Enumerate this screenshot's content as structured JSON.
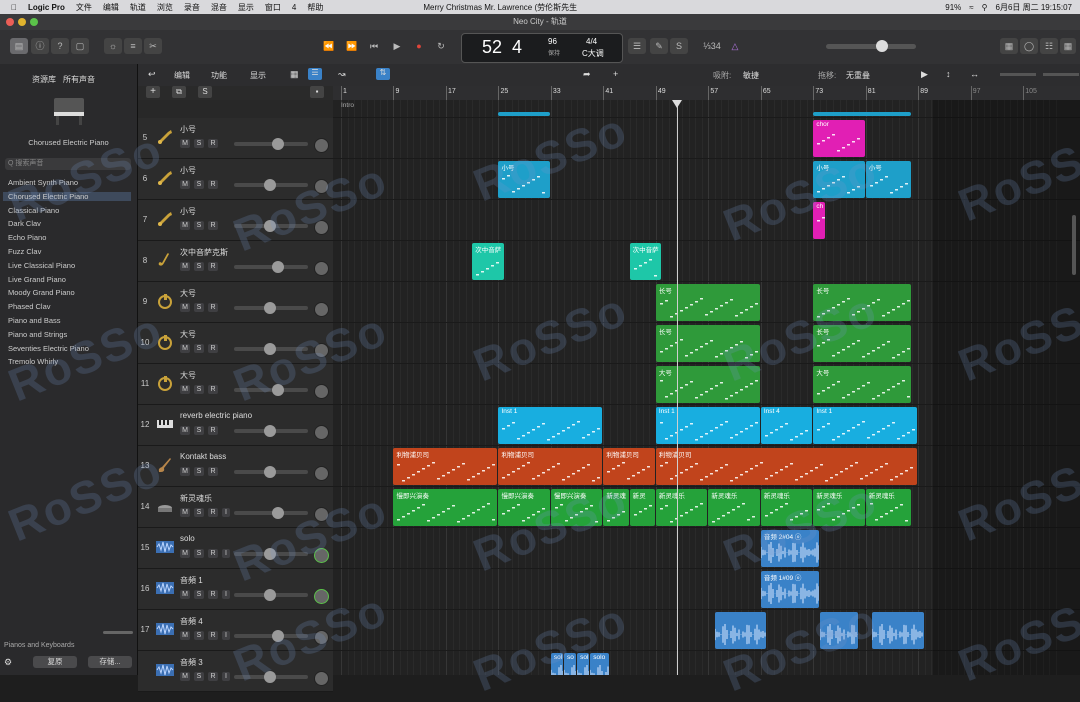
{
  "menubar": {
    "app": "Logic Pro",
    "items": [
      "文件",
      "编辑",
      "轨道",
      "浏览",
      "录音",
      "混音",
      "显示",
      "窗口",
      "4",
      "帮助"
    ],
    "now_playing": "Merry Christmas Mr. Lawrence (劳伦斯先生",
    "battery": "91%",
    "datetime": "6月6日 周二 19:15:07"
  },
  "window": {
    "title": "Neo City - 轨道"
  },
  "lcd": {
    "bar": "52",
    "beat": "4",
    "tempo": "96",
    "tempo_label": "保持",
    "signature": "4/4",
    "key": "C大调",
    "count": "⅓34"
  },
  "library": {
    "tabs": {
      "library": "资源库",
      "all_sounds": "所有声音"
    },
    "preset_name": "Chorused Electric Piano",
    "search_placeholder": "Q 搜索声音",
    "items": [
      "Ambient Synth Piano",
      "Chorused Electric Piano",
      "Classical Piano",
      "Dark Clav",
      "Echo Piano",
      "Fuzz Clav",
      "Live Classical Piano",
      "Live Grand Piano",
      "Moody Grand Piano",
      "Phased Clav",
      "Piano and Bass",
      "Piano and Strings",
      "Seventies Electric Piano",
      "Tremolo Whirly"
    ],
    "selected_index": 1,
    "breadcrumb": "Pianos and Keyboards",
    "restore_label": "复原",
    "save_label": "存储..."
  },
  "toolbar2": {
    "edit": "编辑",
    "function": "功能",
    "view": "显示",
    "snap_label": "吸附:",
    "snap_value": "敏捷",
    "drag_label": "拖移:",
    "drag_value": "无重叠"
  },
  "ruler": {
    "marks": [
      "1",
      "9",
      "17",
      "25",
      "33",
      "41",
      "49",
      "57",
      "65",
      "73",
      "81",
      "89",
      "97",
      "105"
    ],
    "marker": "Intro"
  },
  "tracks": [
    {
      "num": "5",
      "name": "小号",
      "type": "trumpet",
      "r": false
    },
    {
      "num": "6",
      "name": "小号",
      "type": "trumpet",
      "r": false
    },
    {
      "num": "7",
      "name": "小号",
      "type": "trumpet",
      "r": false
    },
    {
      "num": "8",
      "name": "次中音萨克斯",
      "type": "sax",
      "r": false
    },
    {
      "num": "9",
      "name": "大号",
      "type": "tuba",
      "r": false
    },
    {
      "num": "10",
      "name": "大号",
      "type": "tuba",
      "r": false
    },
    {
      "num": "11",
      "name": "大号",
      "type": "tuba",
      "r": false
    },
    {
      "num": "12",
      "name": "reverb electric piano",
      "type": "keys",
      "r": false
    },
    {
      "num": "13",
      "name": "Kontakt bass",
      "type": "bass",
      "r": false
    },
    {
      "num": "14",
      "name": "新灵魂乐",
      "type": "drums",
      "r": true
    },
    {
      "num": "15",
      "name": "solo",
      "type": "audio",
      "r": true
    },
    {
      "num": "16",
      "name": "音頻 1",
      "type": "audio",
      "r": true
    },
    {
      "num": "17",
      "name": "音頻 4",
      "type": "audio",
      "r": true
    },
    {
      "num": "",
      "name": "音頻 3",
      "type": "audio",
      "r": true
    }
  ],
  "regions": [
    {
      "track": 0,
      "start": 73,
      "end": 81,
      "color": "#e11fb4",
      "label": "chor"
    },
    {
      "track": 1,
      "start": 25,
      "end": 33,
      "color": "#1e9fc9",
      "label": "小号"
    },
    {
      "track": 1,
      "start": 73,
      "end": 81,
      "color": "#1e9fc9",
      "label": "小号"
    },
    {
      "track": 1,
      "start": 81,
      "end": 88,
      "color": "#1e9fc9",
      "label": "小号"
    },
    {
      "track": 2,
      "start": 73,
      "end": 75,
      "color": "#e11fb4",
      "label": "ch"
    },
    {
      "track": 3,
      "start": 21,
      "end": 26,
      "color": "#1ec7a8",
      "label": "次中音萨"
    },
    {
      "track": 3,
      "start": 45,
      "end": 50,
      "color": "#1ec7a8",
      "label": "次中音萨"
    },
    {
      "track": 4,
      "start": 49,
      "end": 65,
      "color": "#2f9a3a",
      "label": "长号"
    },
    {
      "track": 4,
      "start": 73,
      "end": 88,
      "color": "#2f9a3a",
      "label": "长号"
    },
    {
      "track": 5,
      "start": 49,
      "end": 65,
      "color": "#2f9a3a",
      "label": "长号"
    },
    {
      "track": 5,
      "start": 73,
      "end": 88,
      "color": "#2f9a3a",
      "label": "长号"
    },
    {
      "track": 6,
      "start": 49,
      "end": 65,
      "color": "#2f9a3a",
      "label": "大号"
    },
    {
      "track": 6,
      "start": 73,
      "end": 88,
      "color": "#2f9a3a",
      "label": "大号"
    },
    {
      "track": 7,
      "start": 25,
      "end": 41,
      "color": "#18aee0",
      "label": "Inst 1"
    },
    {
      "track": 7,
      "start": 49,
      "end": 65,
      "color": "#18aee0",
      "label": "Inst 1"
    },
    {
      "track": 7,
      "start": 65,
      "end": 73,
      "color": "#18aee0",
      "label": "Inst 4"
    },
    {
      "track": 7,
      "start": 73,
      "end": 89,
      "color": "#18aee0",
      "label": "Inst 1"
    },
    {
      "track": 8,
      "start": 9,
      "end": 25,
      "color": "#c1441c",
      "label": "利物浦贝司"
    },
    {
      "track": 8,
      "start": 25,
      "end": 41,
      "color": "#c1441c",
      "label": "利物浦贝司"
    },
    {
      "track": 8,
      "start": 41,
      "end": 49,
      "color": "#c1441c",
      "label": "利物浦贝司"
    },
    {
      "track": 8,
      "start": 49,
      "end": 89,
      "color": "#c1441c",
      "label": "利物浦贝司"
    },
    {
      "track": 9,
      "start": 9,
      "end": 25,
      "color": "#25a23a",
      "label": "慢即兴演奏"
    },
    {
      "track": 9,
      "start": 25,
      "end": 33,
      "color": "#25a23a",
      "label": "慢即兴演奏"
    },
    {
      "track": 9,
      "start": 33,
      "end": 41,
      "color": "#25a23a",
      "label": "慢即兴演奏"
    },
    {
      "track": 9,
      "start": 41,
      "end": 45,
      "color": "#25a23a",
      "label": "新灵魂"
    },
    {
      "track": 9,
      "start": 45,
      "end": 49,
      "color": "#25a23a",
      "label": "新灵"
    },
    {
      "track": 9,
      "start": 49,
      "end": 57,
      "color": "#25a23a",
      "label": "新灵魂乐"
    },
    {
      "track": 9,
      "start": 57,
      "end": 65,
      "color": "#25a23a",
      "label": "新灵魂乐"
    },
    {
      "track": 9,
      "start": 65,
      "end": 73,
      "color": "#25a23a",
      "label": "新灵魂乐"
    },
    {
      "track": 9,
      "start": 73,
      "end": 81,
      "color": "#25a23a",
      "label": "新灵魂乐"
    },
    {
      "track": 9,
      "start": 81,
      "end": 88,
      "color": "#25a23a",
      "label": "新灵魂乐"
    },
    {
      "track": 10,
      "start": 65,
      "end": 74,
      "color": "#3a82c8",
      "label": "音频 2#04 ⓞ"
    },
    {
      "track": 11,
      "start": 65,
      "end": 74,
      "color": "#3a82c8",
      "label": "音频 1#09 ⓞ"
    },
    {
      "track": 12,
      "start": 58,
      "end": 66,
      "color": "#3a82c8",
      "label": ""
    },
    {
      "track": 12,
      "start": 74,
      "end": 80,
      "color": "#3a82c8",
      "label": ""
    },
    {
      "track": 12,
      "start": 82,
      "end": 90,
      "color": "#3a82c8",
      "label": ""
    },
    {
      "track": 13,
      "start": 33,
      "end": 35,
      "color": "#3a82c8",
      "label": "sol"
    },
    {
      "track": 13,
      "start": 35,
      "end": 37,
      "color": "#3a82c8",
      "label": "so"
    },
    {
      "track": 13,
      "start": 37,
      "end": 39,
      "color": "#3a82c8",
      "label": "sol"
    },
    {
      "track": 13,
      "start": 39,
      "end": 42,
      "color": "#3a82c8",
      "label": "solo"
    }
  ],
  "watermark": "RoSSo",
  "colors": {
    "accent": "#3a82c8",
    "record": "#e0453a"
  }
}
